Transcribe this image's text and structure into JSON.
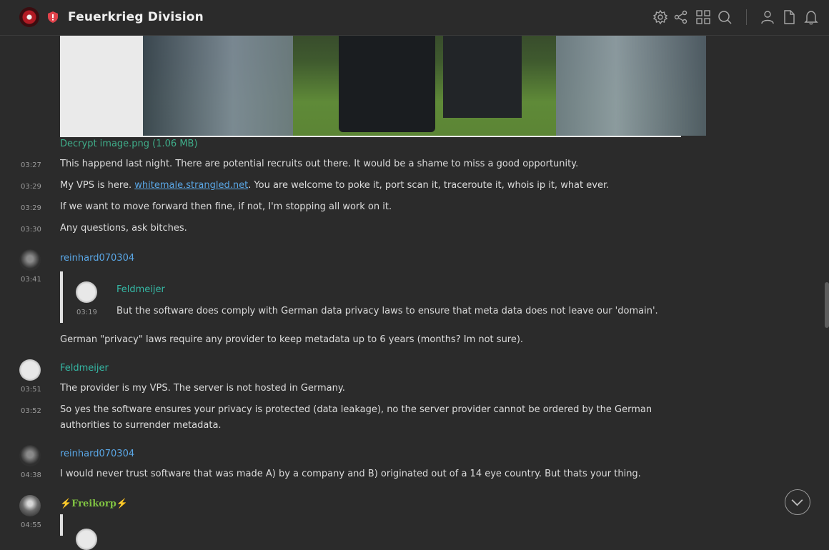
{
  "header": {
    "title": "Feuerkrieg Division",
    "icons": [
      "server-settings-icon",
      "share-icon",
      "apps-icon",
      "search-icon",
      "members-icon",
      "files-icon",
      "notifications-icon"
    ]
  },
  "attachment": {
    "label": "Decrypt image.png (1.06 MB)"
  },
  "messages": [
    {
      "time": "03:27",
      "text": "This happend last night. There are potential recruits out there. It would be a shame to miss a good opportunity."
    },
    {
      "time": "03:29",
      "text_before": "My VPS is here. ",
      "link": "whitemale.strangled.net",
      "text_after": ". You are welcome to poke it, port scan it, traceroute it, whois ip it, what ever."
    },
    {
      "time": "03:29",
      "text": "If we want to move forward then fine, if not, I'm stopping all work on it."
    },
    {
      "time": "03:30",
      "text": "Any questions, ask bitches."
    }
  ],
  "reinhard1": {
    "user": "reinhard070304",
    "time": "03:41",
    "quote_user": "Feldmeijer",
    "quote_time": "03:19",
    "quote_text": "But the software does comply with German data privacy laws to ensure that meta data does not leave our 'domain'.",
    "text": "German \"privacy\" laws require any provider to keep metadata up to 6 years (months? Im not sure)."
  },
  "feldmeijer": {
    "user": "Feldmeijer",
    "time1": "03:51",
    "text1": "The provider is my VPS. The server is not hosted in Germany.",
    "time2": "03:52",
    "text2": "So yes the software ensures your privacy is protected (data leakage), no the server provider cannot be ordered by the German authorities to surrender metadata."
  },
  "reinhard2": {
    "user": "reinhard070304",
    "time": "04:38",
    "text": "I would never trust software that was made A) by a company and B) originated out of a 14 eye country. But thats your thing."
  },
  "freikorp": {
    "user": "⚡Freikorp⚡",
    "time": "04:55"
  }
}
